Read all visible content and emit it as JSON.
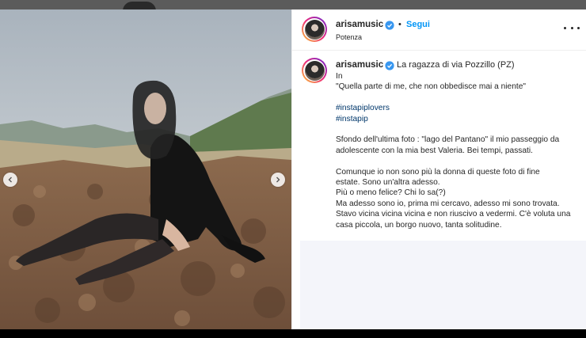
{
  "post": {
    "username": "arisamusic",
    "follow_label": "Segui",
    "separator": "•",
    "location": "Potenza",
    "more_icon": "more-options-icon",
    "verified_icon": "verified-badge-icon"
  },
  "caption": {
    "username": "arisamusic",
    "title": "La ragazza di via Pozzillo (PZ)",
    "lines": [
      "In",
      "\"Quella parte di me, che non obbedisce mai a niente\"",
      "",
      "#instapiplovers",
      "#instapip",
      "",
      "Sfondo dell'ultima foto : \"lago del Pantano\" il mio passeggio da",
      "adolescente con la mia best Valeria. Bei tempi, passati.",
      "",
      "Comunque io non sono più la donna di queste foto di fine",
      "estate. Sono un'altra adesso.",
      "Più o meno felice? Chi lo sa(?)",
      "Ma adesso sono io, prima mi cercavo, adesso mi sono trovata.",
      "Stavo vicina vicina vicina e non riuscivo a vedermi. C'è voluta una",
      "casa piccola, un borgo nuovo, tanta solitudine."
    ]
  },
  "carousel": {
    "prev_icon": "chevron-left-icon",
    "next_icon": "chevron-right-icon"
  },
  "colors": {
    "link": "#0095f6",
    "hashtag": "#00376b",
    "text": "#262626",
    "border": "#efefef"
  }
}
